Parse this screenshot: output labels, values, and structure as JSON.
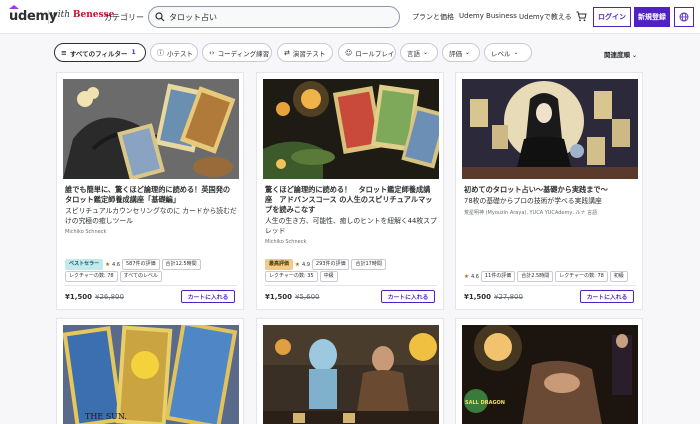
{
  "header": {
    "logo": "udemy",
    "partner": "Benesse",
    "partner_prefix": "with",
    "categories": "カテゴリー",
    "search_value": "タロット占い",
    "link_plans": "プランと価格",
    "link_business": "Udemy Business",
    "link_teach": "Udemyで教える",
    "login": "ログイン",
    "signup": "新規登録"
  },
  "filters": {
    "all": "すべてのフィルター",
    "all_count": "1",
    "quiz": "小テスト",
    "coding": "コーディング練習",
    "practice": "演習テスト",
    "roleplay": "ロールプレイ",
    "language": "言語",
    "rating": "評価",
    "level": "レベル",
    "sort": "関連度順"
  },
  "cards": [
    {
      "title": "誰でも簡単に、驚くほど論理的に読める！英国発のタロット鑑定師養成講座「基礎編」",
      "subtitle": "スピリチュアルカウンセリングなのに カードから読むだけの究極の癒しツール",
      "author": "Michiko Schneck",
      "badge": "ベストセラー",
      "rating": "4.6",
      "reviews": "587件の評価",
      "hours": "合計12.5時間",
      "lectures": "レクチャーの数: 78",
      "level": "すべてのレベル",
      "price": "¥1,500",
      "orig_price": "¥26,800",
      "cart": "カートに入れる"
    },
    {
      "title": "驚くほど論理的に読める！　タロット鑑定師養成講座　アドバンスコース の人生のスピリチュアルマップを読みこなす",
      "subtitle": "人生の生き方、可能性、癒しのヒントを紐解く44枚スプレッド",
      "author": "Michiko Schneck",
      "badge": "最高評価",
      "rating": "4.9",
      "reviews": "293件の評価",
      "hours": "合計17時間",
      "lectures": "レクチャーの数: 35",
      "level": "中級",
      "price": "¥1,500",
      "orig_price": "¥5,600",
      "cart": "カートに入れる"
    },
    {
      "title": "初めてのタロット占い〜基礎から実践まで〜",
      "subtitle": "78枚の基礎からプロの技術が学べる実践講座",
      "author": "荒星明神 (Myouzin Araya), YUCA YUCAdemy, ルナ 言語",
      "rating": "4.6",
      "reviews": "11件の評価",
      "hours": "合計2.5時間",
      "lectures": "レクチャーの数: 78",
      "level": "初級",
      "price": "¥1,500",
      "orig_price": "¥27,800",
      "cart": "カートに入れる"
    }
  ],
  "thumb_text": {
    "card4_sun": "THE SUN.",
    "card6_logo": "SALL DRAGON"
  }
}
